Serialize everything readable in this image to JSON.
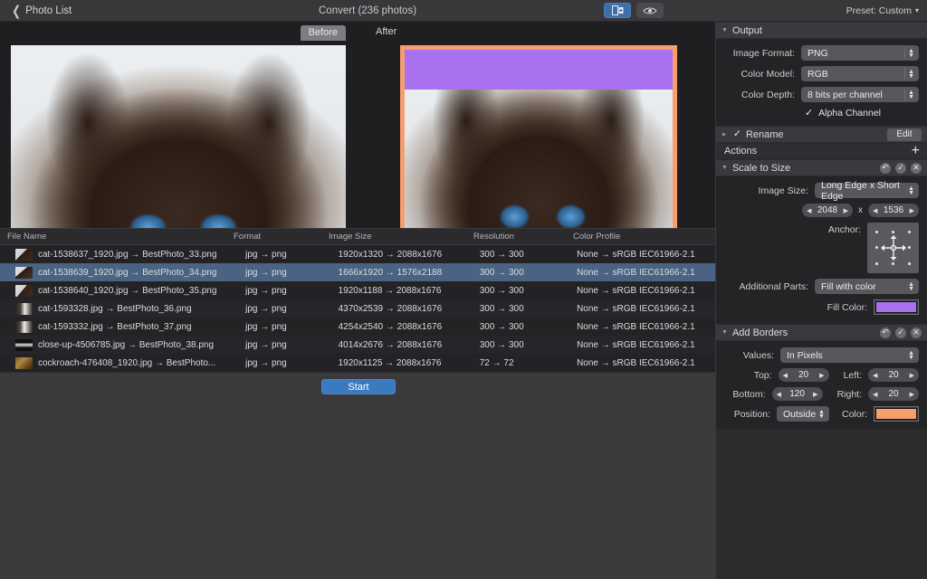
{
  "titlebar": {
    "back_label": "Photo List",
    "back_icon": "chevron-left-icon",
    "title": "Convert (236 photos)",
    "toggle_compare_icon": "split-view-icon",
    "toggle_preview_icon": "eye-icon"
  },
  "preview": {
    "before_label": "Before",
    "after_label": "After",
    "border_color": "#f79e6e",
    "fill_color": "#a970f0"
  },
  "table": {
    "columns": [
      "File Name",
      "Format",
      "Image Size",
      "Resolution",
      "Color Profile"
    ],
    "rows": [
      {
        "name": "cat-1538637_1920.jpg → BestPhoto_33.png",
        "format": "jpg → png",
        "size": "1920x1320 → 2088x1676",
        "res": "300 → 300",
        "profile": "None → sRGB IEC61966-2.1",
        "selected": false
      },
      {
        "name": "cat-1538639_1920.jpg → BestPhoto_34.png",
        "format": "jpg → png",
        "size": "1666x1920 → 1576x2188",
        "res": "300 → 300",
        "profile": "None → sRGB IEC61966-2.1",
        "selected": true
      },
      {
        "name": "cat-1538640_1920.jpg → BestPhoto_35.png",
        "format": "jpg → png",
        "size": "1920x1188 → 2088x1676",
        "res": "300 → 300",
        "profile": "None → sRGB IEC61966-2.1",
        "selected": false
      },
      {
        "name": "cat-1593328.jpg → BestPhoto_36.png",
        "format": "jpg → png",
        "size": "4370x2539 → 2088x1676",
        "res": "300 → 300",
        "profile": "None → sRGB IEC61966-2.1",
        "selected": false
      },
      {
        "name": "cat-1593332.jpg → BestPhoto_37.png",
        "format": "jpg → png",
        "size": "4254x2540 → 2088x1676",
        "res": "300 → 300",
        "profile": "None → sRGB IEC61966-2.1",
        "selected": false
      },
      {
        "name": "close-up-4506785.jpg → BestPhoto_38.png",
        "format": "jpg → png",
        "size": "4014x2676 → 2088x1676",
        "res": "300 → 300",
        "profile": "None → sRGB IEC61966-2.1",
        "selected": false
      },
      {
        "name": "cockroach-476408_1920.jpg → BestPhoto...",
        "format": "jpg → png",
        "size": "1920x1125 → 2088x1676",
        "res": "72 → 72",
        "profile": "None → sRGB IEC61966-2.1",
        "selected": false
      }
    ]
  },
  "footer": {
    "start_label": "Start"
  },
  "panel": {
    "preset_label": "Preset: Custom",
    "preset_caret": "▾",
    "output": {
      "title": "Output",
      "image_format_label": "Image Format:",
      "image_format_value": "PNG",
      "color_model_label": "Color Model:",
      "color_model_value": "RGB",
      "color_depth_label": "Color Depth:",
      "color_depth_value": "8 bits per channel",
      "alpha_label": "Alpha Channel",
      "alpha_checked": "✓"
    },
    "rename": {
      "title": "Rename",
      "checked": "✓",
      "edit_label": "Edit"
    },
    "actions": {
      "title": "Actions",
      "add_icon": "plus-icon"
    },
    "scale_to_size": {
      "title": "Scale to Size",
      "image_size_label": "Image Size:",
      "image_size_value": "Long Edge x Short Edge",
      "width_value": "2048",
      "times": "x",
      "height_value": "1536",
      "anchor_label": "Anchor:",
      "additional_parts_label": "Additional Parts:",
      "additional_parts_value": "Fill with color",
      "fill_color_label": "Fill Color:",
      "fill_color_value": "#a970f0"
    },
    "add_borders": {
      "title": "Add Borders",
      "values_label": "Values:",
      "values_value": "In Pixels",
      "top_label": "Top:",
      "top_value": "20",
      "left_label": "Left:",
      "left_value": "20",
      "bottom_label": "Bottom:",
      "bottom_value": "120",
      "right_label": "Right:",
      "right_value": "20",
      "position_label": "Position:",
      "position_value": "Outside",
      "color_label": "Color:",
      "color_value": "#f79e6e"
    },
    "section_icons": {
      "reset": "revert-icon",
      "apply": "check-icon",
      "remove": "close-icon"
    }
  }
}
